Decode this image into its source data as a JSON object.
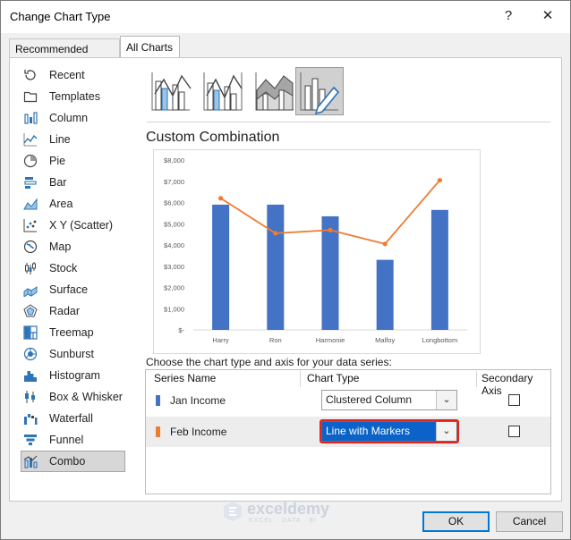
{
  "dialog": {
    "title": "Change Chart Type",
    "help_label": "?",
    "close_label": "✕"
  },
  "tabs": [
    {
      "label": "Recommended Charts",
      "active": false
    },
    {
      "label": "All Charts",
      "active": true
    }
  ],
  "sidebar": {
    "items": [
      {
        "label": "Recent",
        "icon": "recent-icon"
      },
      {
        "label": "Templates",
        "icon": "templates-icon"
      },
      {
        "label": "Column",
        "icon": "column-chart-icon"
      },
      {
        "label": "Line",
        "icon": "line-chart-icon"
      },
      {
        "label": "Pie",
        "icon": "pie-chart-icon"
      },
      {
        "label": "Bar",
        "icon": "bar-chart-icon"
      },
      {
        "label": "Area",
        "icon": "area-chart-icon"
      },
      {
        "label": "X Y (Scatter)",
        "icon": "scatter-chart-icon"
      },
      {
        "label": "Map",
        "icon": "map-chart-icon"
      },
      {
        "label": "Stock",
        "icon": "stock-chart-icon"
      },
      {
        "label": "Surface",
        "icon": "surface-chart-icon"
      },
      {
        "label": "Radar",
        "icon": "radar-chart-icon"
      },
      {
        "label": "Treemap",
        "icon": "treemap-chart-icon"
      },
      {
        "label": "Sunburst",
        "icon": "sunburst-chart-icon"
      },
      {
        "label": "Histogram",
        "icon": "histogram-chart-icon"
      },
      {
        "label": "Box & Whisker",
        "icon": "box-whisker-chart-icon"
      },
      {
        "label": "Waterfall",
        "icon": "waterfall-chart-icon"
      },
      {
        "label": "Funnel",
        "icon": "funnel-chart-icon"
      },
      {
        "label": "Combo",
        "icon": "combo-chart-icon",
        "selected": true
      }
    ]
  },
  "combo_types": [
    {
      "icon": "clustered-column-line-icon",
      "selected": false
    },
    {
      "icon": "clustered-column-line-secondary-axis-icon",
      "selected": false
    },
    {
      "icon": "stacked-area-clustered-column-icon",
      "selected": false
    },
    {
      "icon": "custom-combination-icon",
      "selected": true
    }
  ],
  "main": {
    "section_title": "Custom Combination",
    "instruction": "Choose the chart type and axis for your data series:"
  },
  "series_table": {
    "headers": {
      "name": "Series Name",
      "type": "Chart Type",
      "axis": "Secondary Axis"
    },
    "rows": [
      {
        "name": "Jan Income",
        "color": "#4472C4",
        "chart_type": "Clustered Column",
        "secondary_axis": false,
        "active": false
      },
      {
        "name": "Feb Income",
        "color": "#ED7D31",
        "chart_type": "Line with Markers",
        "secondary_axis": false,
        "active": true
      }
    ]
  },
  "buttons": {
    "ok": "OK",
    "cancel": "Cancel"
  },
  "watermark": {
    "name": "exceldemy",
    "tagline": "EXCEL · DATA · BI"
  },
  "chart_data": {
    "type": "bar",
    "categories": [
      "Harry",
      "Ron",
      "Harmonie",
      "Malfoy",
      "Longbottom"
    ],
    "series": [
      {
        "type": "bar",
        "color": "#4472C4",
        "values": [
          5900,
          5900,
          5350,
          3300,
          5650
        ]
      },
      {
        "type": "line",
        "color": "#ED7D31",
        "values": [
          6200,
          4550,
          4700,
          4050,
          7050
        ]
      }
    ],
    "ylim": [
      0,
      8000
    ],
    "y_ticks": [
      "$-",
      "$1,000",
      "$2,000",
      "$3,000",
      "$4,000",
      "$5,000",
      "$6,000",
      "$7,000",
      "$8,000"
    ],
    "grid": false,
    "legend": "none"
  }
}
